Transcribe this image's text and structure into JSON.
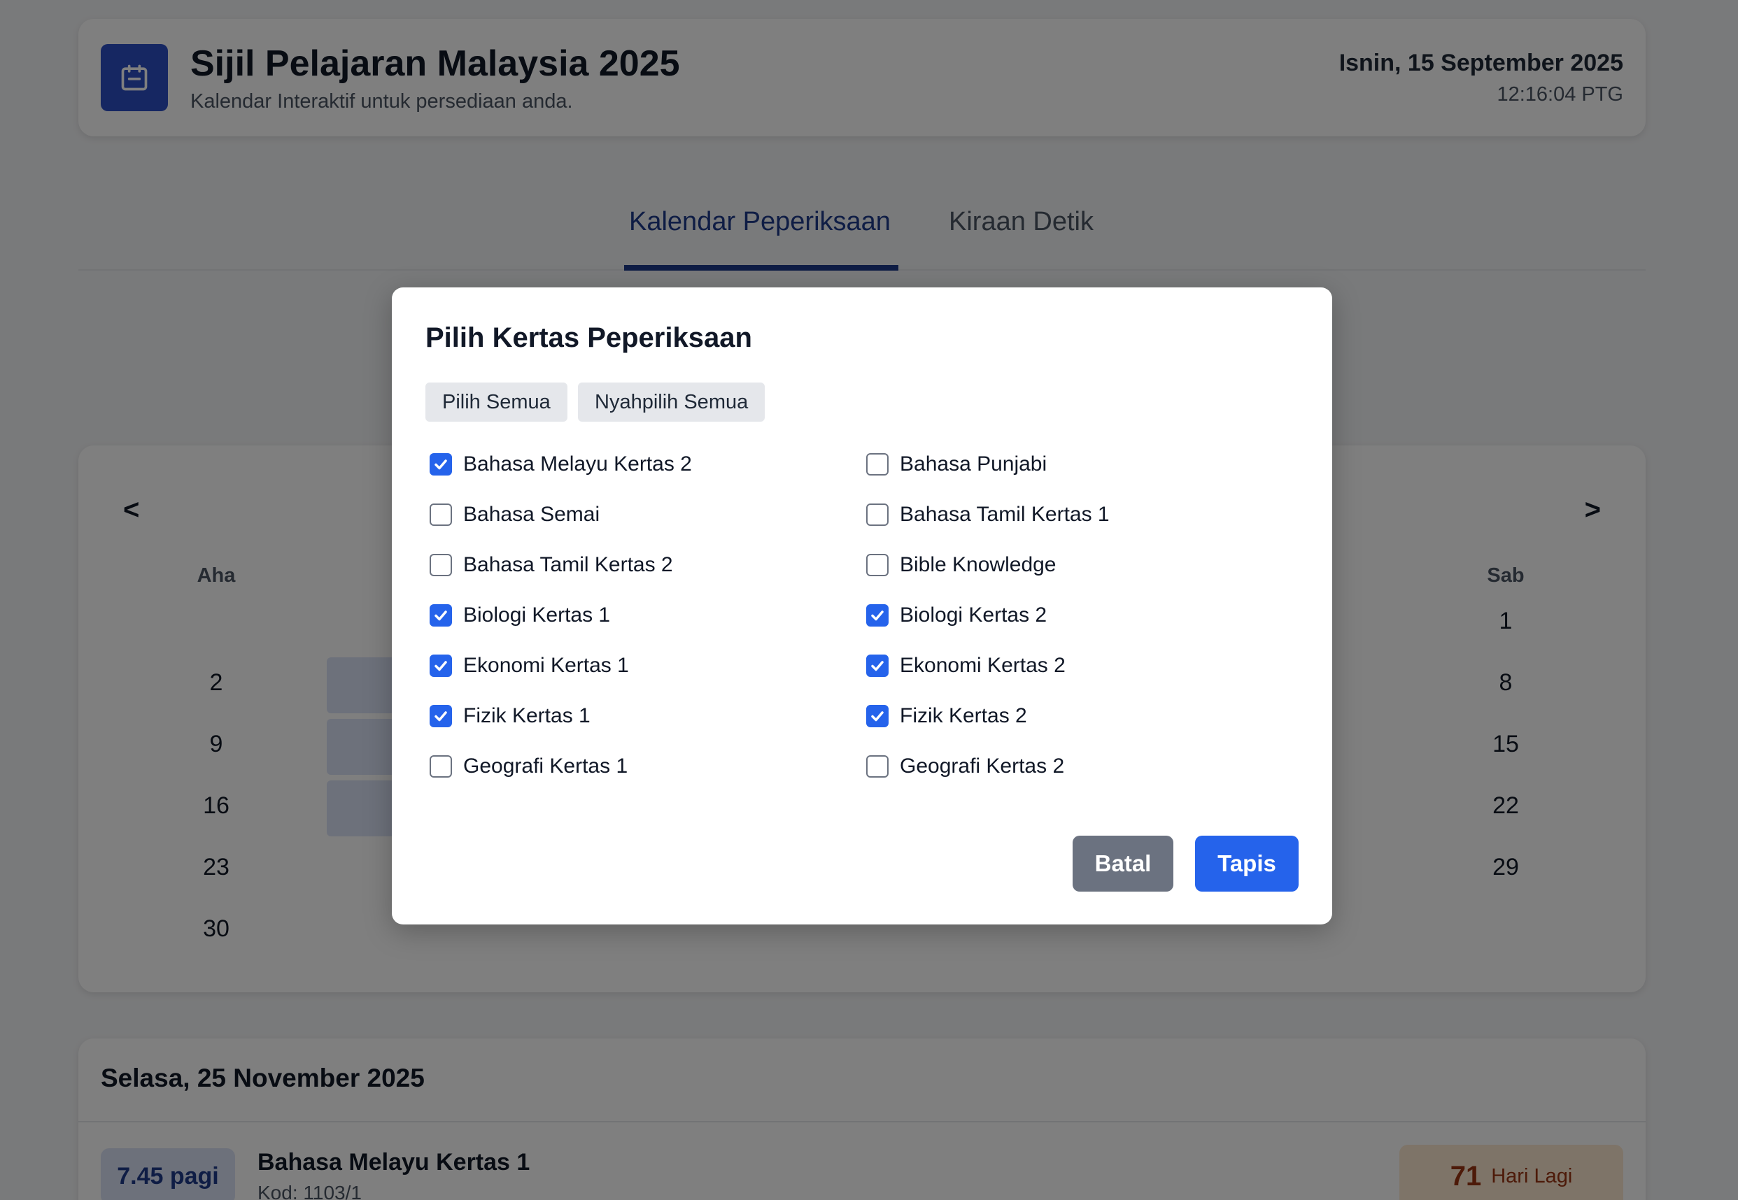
{
  "header": {
    "title": "Sijil Pelajaran Malaysia 2025",
    "subtitle": "Kalendar Interaktif untuk persediaan anda.",
    "date": "Isnin, 15 September 2025",
    "time": "12:16:04 PTG"
  },
  "tabs": [
    {
      "label": "Kalendar Peperiksaan",
      "active": true
    },
    {
      "label": "Kiraan Detik",
      "active": false
    }
  ],
  "calendar": {
    "prev": "<",
    "next": ">",
    "weekday_left": "Aha",
    "weekday_right": "Sab",
    "days_left": [
      "2",
      "9",
      "16",
      "23",
      "30"
    ],
    "days_right": [
      "1",
      "8",
      "15",
      "22",
      "29"
    ]
  },
  "details": {
    "date_heading": "Selasa, 25 November 2025",
    "time_badge": "7.45 pagi",
    "exam_name": "Bahasa Melayu Kertas 1",
    "exam_code": "Kod: 1103/1",
    "days_count": "71",
    "days_label": "Hari Lagi"
  },
  "modal": {
    "title": "Pilih Kertas Peperiksaan",
    "select_all": "Pilih Semua",
    "deselect_all": "Nyahpilih Semua",
    "options": [
      {
        "label": "Bahasa Melayu Kertas 2",
        "checked": true
      },
      {
        "label": "Bahasa Punjabi",
        "checked": false
      },
      {
        "label": "Bahasa Semai",
        "checked": false
      },
      {
        "label": "Bahasa Tamil Kertas 1",
        "checked": false
      },
      {
        "label": "Bahasa Tamil Kertas 2",
        "checked": false
      },
      {
        "label": "Bible Knowledge",
        "checked": false
      },
      {
        "label": "Biologi Kertas 1",
        "checked": true
      },
      {
        "label": "Biologi Kertas 2",
        "checked": true
      },
      {
        "label": "Ekonomi Kertas 1",
        "checked": true
      },
      {
        "label": "Ekonomi Kertas 2",
        "checked": true
      },
      {
        "label": "Fizik Kertas 1",
        "checked": true
      },
      {
        "label": "Fizik Kertas 2",
        "checked": true
      },
      {
        "label": "Geografi Kertas 1",
        "checked": false
      },
      {
        "label": "Geografi Kertas 2",
        "checked": false
      }
    ],
    "cancel": "Batal",
    "apply": "Tapis"
  },
  "colors": {
    "primary": "#2563eb",
    "brand": "#2d4fc4",
    "tab_active": "#1e3a8a",
    "cancel_button": "#6b7280"
  },
  "icons": {
    "app": "calendar-icon",
    "checkbox": "check-icon"
  }
}
